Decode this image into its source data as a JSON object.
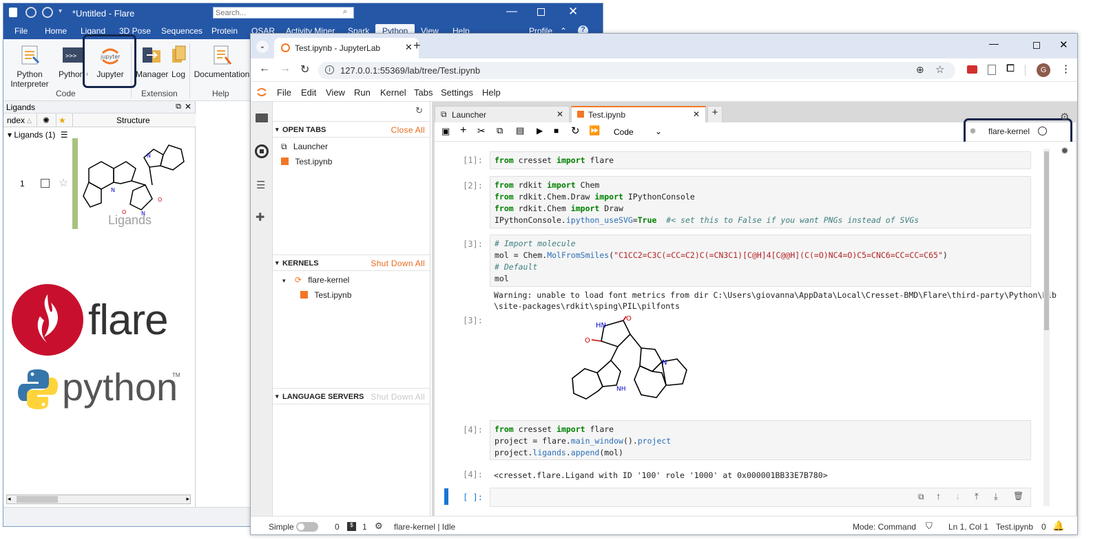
{
  "flare": {
    "title": "*Untitled - Flare",
    "search_placeholder": "Search...",
    "menu": [
      "File",
      "Home",
      "Ligand",
      "3D Pose",
      "Sequences",
      "Protein",
      "QSAR",
      "Activity Miner",
      "Spark",
      "Python",
      "View",
      "Help"
    ],
    "active_menu": "Python",
    "profile_label": "Profile",
    "ribbon": {
      "python_interpreter": "Python Interpreter",
      "python_console": "Python Console",
      "jupyter": "Jupyter",
      "manager": "Manager",
      "log": "Log",
      "documentation": "Documentation",
      "group_code": "Code",
      "group_extension": "Extension",
      "group_help": "Help",
      "jupyter_logo_text": "jupyter"
    },
    "ligands_panel": {
      "title": "Ligands",
      "col_index": "ndex",
      "col_structure": "Structure",
      "group_label": "Ligands (1)",
      "row_index": "1",
      "watermark": "Ligands"
    },
    "logos": {
      "flare_text": "flare",
      "python_text": "python",
      "tm": "TM"
    }
  },
  "browser": {
    "tab_title": "Test.ipynb - JupyterLab",
    "url": "127.0.0.1:55369/lab/tree/Test.ipynb",
    "avatar_letter": "G"
  },
  "jupyterlab": {
    "menu": [
      "File",
      "Edit",
      "View",
      "Run",
      "Kernel",
      "Tabs",
      "Settings",
      "Help"
    ],
    "open_tabs": {
      "title": "OPEN TABS",
      "action": "Close All",
      "items": [
        "Launcher",
        "Test.ipynb"
      ]
    },
    "kernels": {
      "title": "KERNELS",
      "action": "Shut Down All",
      "kernel": "flare-kernel",
      "notebook": "Test.ipynb"
    },
    "language_servers": {
      "title": "LANGUAGE SERVERS",
      "action": "Shut Down All"
    },
    "doc_tabs": [
      "Launcher",
      "Test.ipynb"
    ],
    "cell_type": "Code",
    "kernel_name": "flare-kernel",
    "cells": {
      "c1_prompt": "[1]:",
      "c1_l1": [
        "from",
        " cresset ",
        "import",
        " flare"
      ],
      "c2_prompt": "[2]:",
      "c2_l1": [
        "from",
        " rdkit ",
        "import",
        " Chem"
      ],
      "c2_l2": [
        "from",
        " rdkit.Chem.Draw ",
        "import",
        " IPythonConsole"
      ],
      "c2_l3": [
        "from",
        " rdkit.Chem ",
        "import",
        " Draw"
      ],
      "c2_l4": [
        "IPythonConsole.",
        "ipython_useSVG",
        "=",
        "True",
        "  #< set this to False if you want PNGs instead of SVGs"
      ],
      "c3_prompt": "[3]:",
      "c3_l1": "# Import molecule",
      "c3_l2": [
        "mol ",
        "=",
        " Chem.",
        "MolFromSmiles",
        "(",
        "\"C1CC2=C3C(=CC=C2)C(=CN3C1)[C@H]4[C@@H](C(=O)NC4=O)C5=CNC6=CC=CC=C65\"",
        ")"
      ],
      "c3_l3": "# Default",
      "c3_l4": "mol",
      "c3_warn_1": "Warning: unable to load font metrics from dir C:\\Users\\giovanna\\AppData\\Local\\Cresset-BMD\\Flare\\third-party\\Python\\Lib",
      "c3_warn_2": "\\site-packages\\rdkit\\sping\\PIL\\pilfonts",
      "c3_out_prompt": "[3]:",
      "mol_labels": {
        "hn": "HN",
        "o": "O",
        "n": "N",
        "nh": "NH"
      },
      "c4_prompt": "[4]:",
      "c4_l1": [
        "from",
        " cresset ",
        "import",
        " flare"
      ],
      "c4_l2": [
        "project ",
        "=",
        " flare.",
        "main_window",
        "().",
        "project"
      ],
      "c4_l3": [
        "project.",
        "ligands",
        ".",
        "append",
        "(mol)"
      ],
      "c4_out_prompt": "[4]:",
      "c4_out": "<cresset.flare.Ligand with ID '100' role '1000' at 0x000001BB33E7B780>",
      "c5_prompt": "[ ]:"
    },
    "status": {
      "simple": "Simple",
      "zero": "0",
      "terminals": "1",
      "kernel_status": "flare-kernel | Idle",
      "mode": "Mode: Command",
      "position": "Ln 1, Col 1",
      "file": "Test.ipynb",
      "notifications": "0"
    }
  }
}
